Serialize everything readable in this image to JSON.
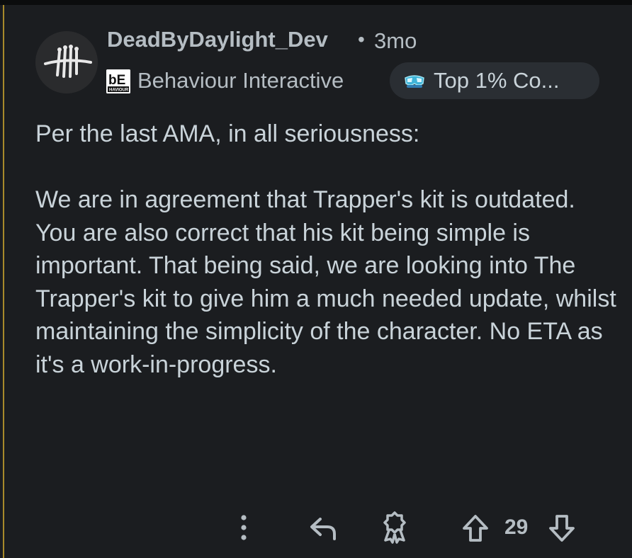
{
  "comment": {
    "username": "DeadByDaylight_Dev",
    "separator": "•",
    "timestamp": "3mo",
    "flair": {
      "logo_text": "bE",
      "logo_subtext": "HAVIOUR",
      "text": "Behaviour Interactive"
    },
    "badge": {
      "icon": "goggles-icon",
      "text": "Top 1% Co..."
    },
    "paragraphs": [
      "Per the last AMA, in all seriousness:",
      "We are in agreement that Trapper's kit is outdated. You are also correct that his kit being simple is important. That being said, we are looking into The Trapper's kit to give him a much needed update, whilst maintaining the simplicity of the character. No ETA as it's a work-in-progress."
    ],
    "actions": {
      "more_icon": "more-vertical-icon",
      "reply_icon": "reply-icon",
      "award_icon": "award-icon",
      "upvote_icon": "upvote-arrow-icon",
      "downvote_icon": "downvote-arrow-icon",
      "vote_count": "29"
    }
  },
  "colors": {
    "background": "#1b1d20",
    "text": "#c9d3d9",
    "meta_text": "#b5bdc3",
    "thread_line": "#a88a2a",
    "badge_bg": "#2a2e33"
  }
}
